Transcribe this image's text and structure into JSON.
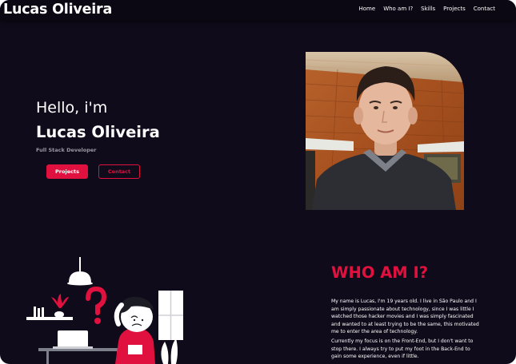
{
  "navbar": {
    "brand": "Lucas Oliveira",
    "links": [
      "Home",
      "Who am I?",
      "Skills",
      "Projects",
      "Contact"
    ]
  },
  "hero": {
    "greeting": "Hello, i'm",
    "name": "Lucas Oliveira",
    "role": "Full Stack Developer",
    "primary_button": "Projects",
    "secondary_button": "Contact"
  },
  "about": {
    "title": "WHO AM I?",
    "paragraph1": "My name is Lucas, I'm 19 years old. I live in São Paulo and I am simply passionate about technology, since I was little I watched those hacker movies and I was simply fascinated and wanted to at least trying to be the same, this motivated me to enter the area of technology.",
    "paragraph2": "Currently my focus is on the Front-End, but I don't want to stop there. I always try to put my foot in the Back-End to gain some experience, even if little."
  },
  "colors": {
    "accent": "#e0113f",
    "background": "#100b1a",
    "navbar": "#0b0813"
  }
}
